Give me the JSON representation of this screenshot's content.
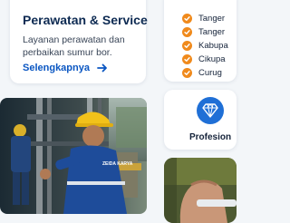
{
  "service_card": {
    "title": "Perawatan & Service",
    "description": "Layanan perawatan dan perbaikan sumur bor.",
    "link_label": "Selengkapnya"
  },
  "checklist": {
    "items": [
      {
        "label": "Tanger",
        "icon": "check-icon"
      },
      {
        "label": "Tanger",
        "icon": "check-icon"
      },
      {
        "label": "Kabupa",
        "icon": "check-icon"
      },
      {
        "label": "Cikupa",
        "icon": "check-icon"
      },
      {
        "label": "Curug",
        "icon": "check-icon"
      }
    ]
  },
  "photo": {
    "shirt_text": "ZEIDA KARYA"
  },
  "feature": {
    "icon": "diamond-icon",
    "label": "Profesion"
  },
  "colors": {
    "accent_blue": "#0a56c2",
    "title_navy": "#0d2a52",
    "check_orange": "#f08a1c",
    "badge_blue": "#1f6fd6"
  }
}
